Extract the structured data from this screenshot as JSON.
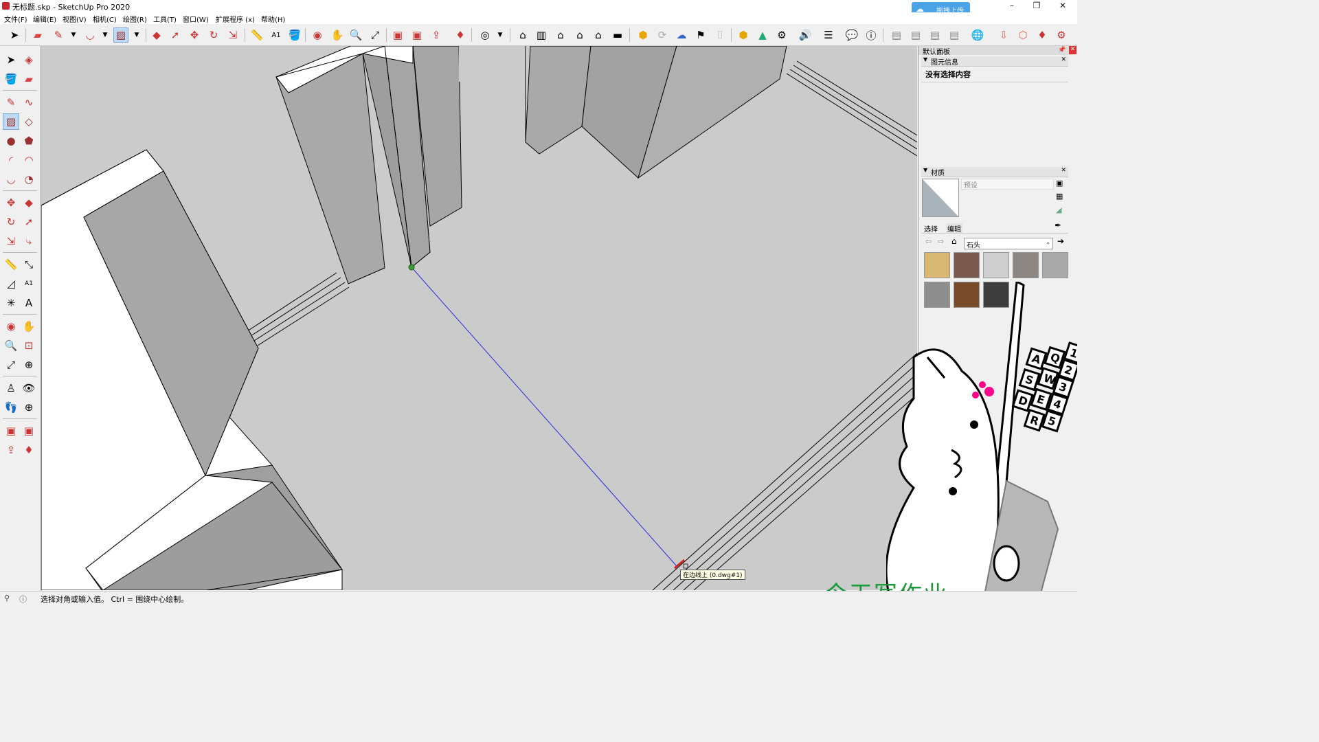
{
  "window": {
    "title": "无标题.skp - SketchUp Pro 2020",
    "cloud_upload": "拖拽上传",
    "minimize": "–",
    "maximize": "❐",
    "close": "✕"
  },
  "menu": [
    "文件(F)",
    "编辑(E)",
    "视图(V)",
    "相机(C)",
    "绘图(R)",
    "工具(T)",
    "窗口(W)",
    "扩展程序 (x)",
    "帮助(H)"
  ],
  "viewport": {
    "tooltip": "在边线上 (0.dwg#1)"
  },
  "panel": {
    "title": "默认面板",
    "entity_info": {
      "header": "图元信息",
      "status": "没有选择内容"
    },
    "materials": {
      "header": "材质",
      "name_placeholder": "预设",
      "tab_select": "选择",
      "tab_edit": "编辑",
      "library": "石头",
      "swatches": [
        {
          "color": "#d9b873"
        },
        {
          "color": "#7a5a4e"
        },
        {
          "color": "#cfcfcf"
        },
        {
          "color": "#8d8783"
        },
        {
          "color": "#a9a9a9"
        },
        {
          "color": "#8e8e8e"
        },
        {
          "color": "#7a4b2a"
        },
        {
          "color": "#3d3d3d"
        }
      ]
    }
  },
  "status_bar": {
    "message": "选择对角或输入值。 Ctrl = 围绕中心绘制。"
  },
  "watermark": "今天写作业",
  "overlay_keys": [
    "Q",
    "W",
    "E",
    "R",
    "A",
    "S",
    "D",
    "1",
    "2",
    "3",
    "4",
    "5"
  ]
}
